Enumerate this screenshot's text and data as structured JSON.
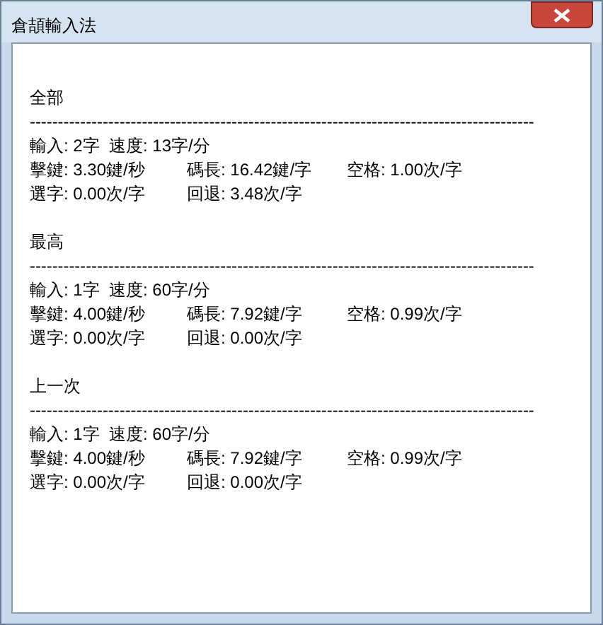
{
  "window": {
    "title": "倉頡輸入法"
  },
  "sections": [
    {
      "title": "全部",
      "separator": "------------------------------------------------------------------------------------------",
      "summary": "輸入: 2字  速度: 13字/分",
      "stats": [
        [
          "擊鍵: 3.30鍵/秒",
          "碼長: 16.42鍵/字",
          "空格: 1.00次/字"
        ],
        [
          "選字: 0.00次/字",
          "回退: 3.48次/字"
        ]
      ]
    },
    {
      "title": "最高",
      "separator": "------------------------------------------------------------------------------------------",
      "summary": "輸入: 1字  速度: 60字/分",
      "stats": [
        [
          "擊鍵: 4.00鍵/秒",
          "碼長: 7.92鍵/字",
          "空格: 0.99次/字"
        ],
        [
          "選字: 0.00次/字",
          "回退: 0.00次/字"
        ]
      ]
    },
    {
      "title": "上一次",
      "separator": "------------------------------------------------------------------------------------------",
      "summary": "輸入: 1字  速度: 60字/分",
      "stats": [
        [
          "擊鍵: 4.00鍵/秒",
          "碼長: 7.92鍵/字",
          "空格: 0.99次/字"
        ],
        [
          "選字: 0.00次/字",
          "回退: 0.00次/字"
        ]
      ]
    }
  ]
}
